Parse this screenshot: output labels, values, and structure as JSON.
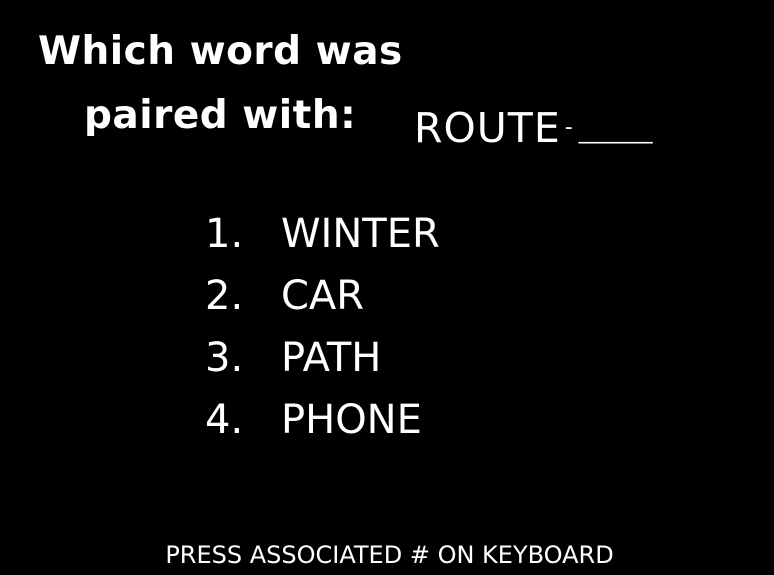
{
  "prompt": {
    "line1": "Which word was",
    "line2": "paired with:"
  },
  "cue": {
    "word": "ROUTE",
    "dash": "-",
    "blank": "________"
  },
  "options": [
    {
      "number": "1.",
      "word": "WINTER"
    },
    {
      "number": "2.",
      "word": "CAR"
    },
    {
      "number": "3.",
      "word": "PATH"
    },
    {
      "number": "4.",
      "word": "PHONE"
    }
  ],
  "instruction": "PRESS ASSOCIATED # ON KEYBOARD",
  "colors": {
    "background": "#000000",
    "text": "#ffffff"
  }
}
